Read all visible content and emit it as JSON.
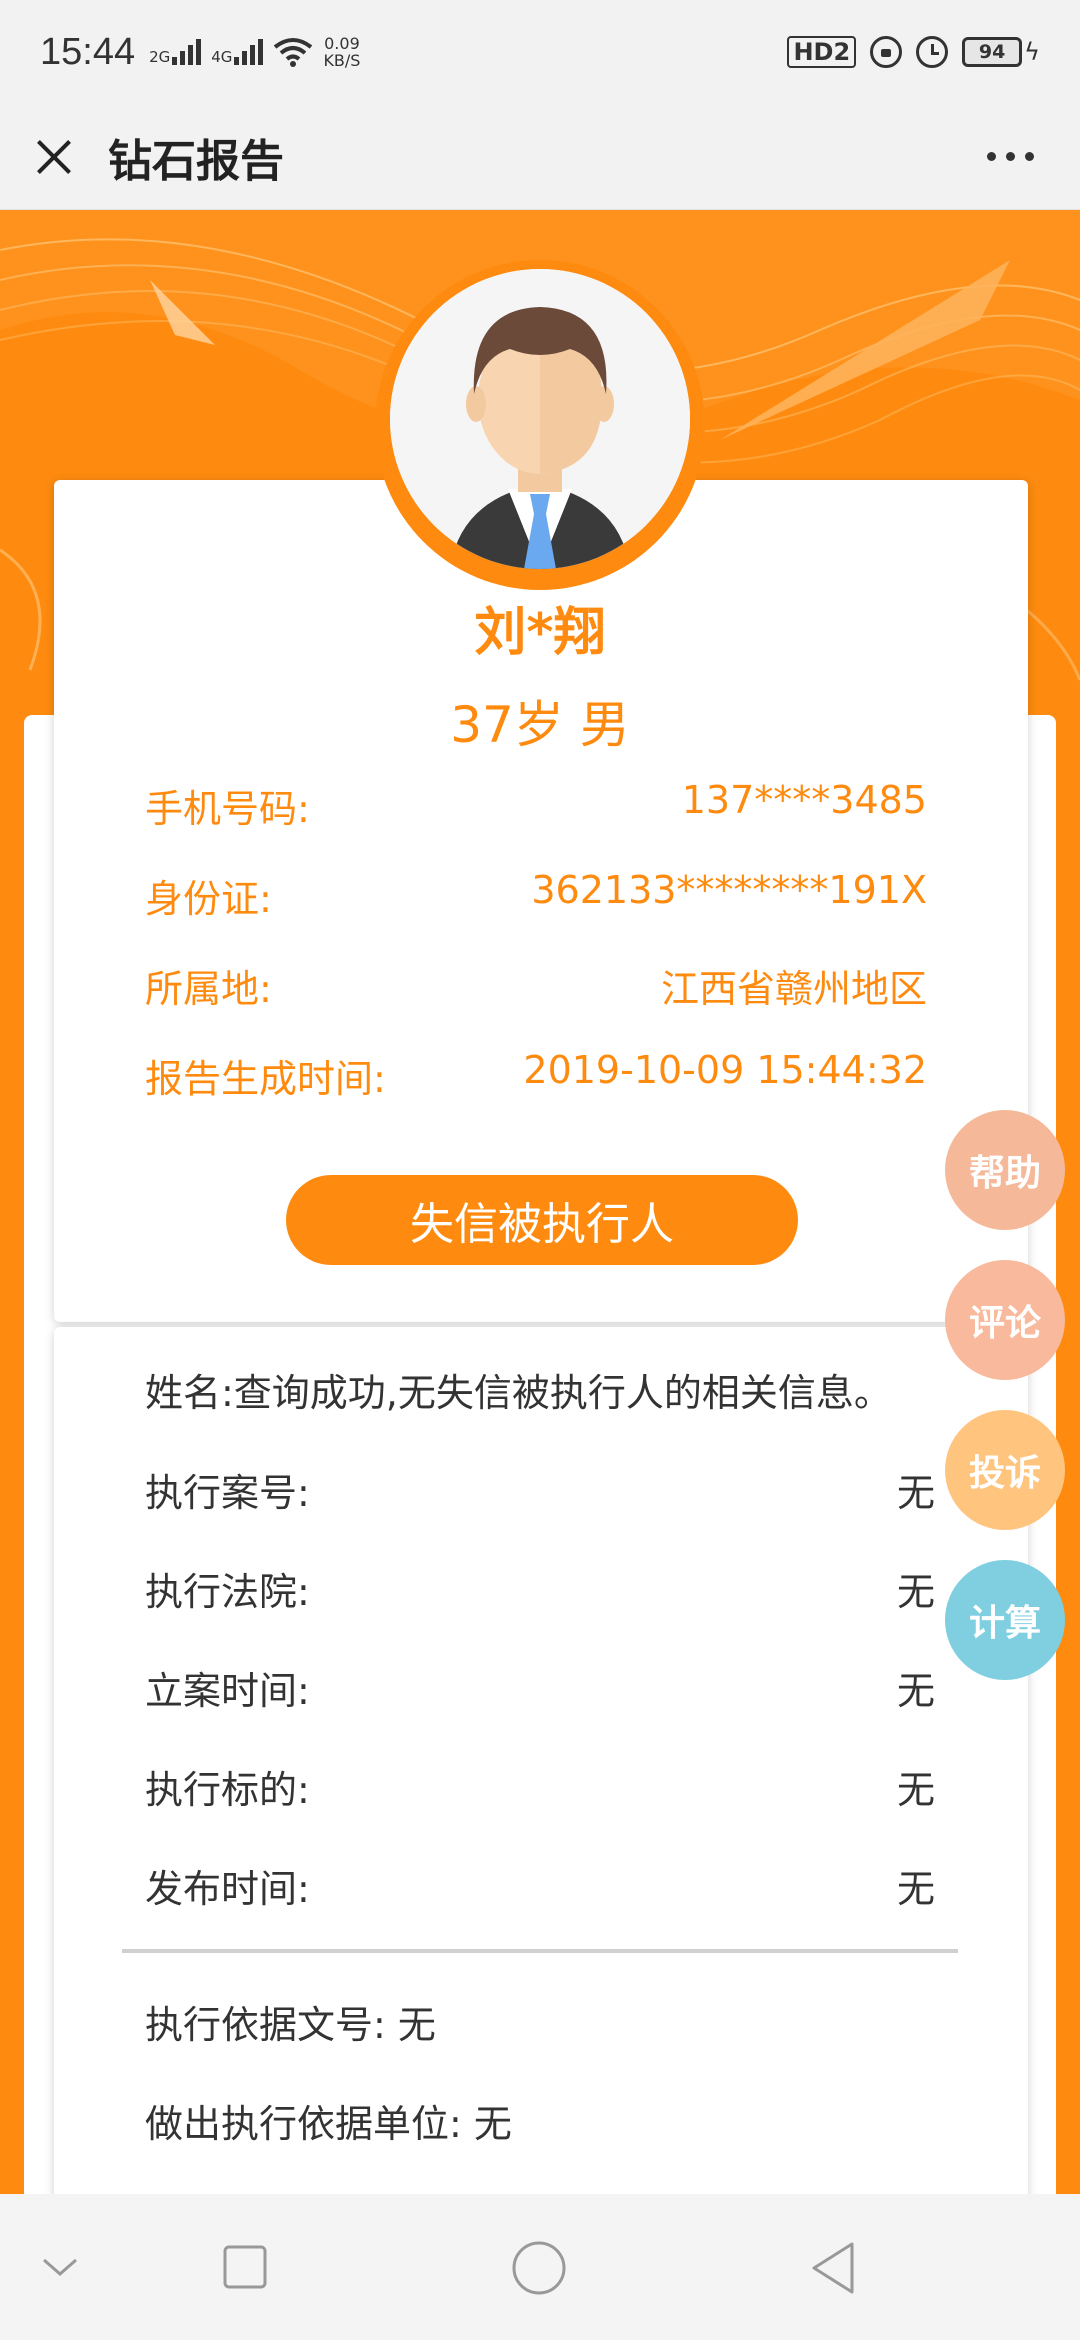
{
  "status_bar": {
    "time": "15:44",
    "signal1_label": "2G",
    "signal2_label": "4G",
    "net_speed_value": "0.09",
    "net_speed_unit": "KB/S",
    "hd_label": "HD2",
    "battery_level": "94",
    "icons": [
      "signal-icon",
      "wifi-icon",
      "hd-icon",
      "lock-rotation-icon",
      "alarm-icon",
      "battery-icon",
      "charging-icon"
    ]
  },
  "title_bar": {
    "title": "钻石报告",
    "close_icon": "close-icon",
    "more_icon": "more-dots-icon"
  },
  "profile": {
    "name": "刘*翔",
    "age_gender": "37岁 男",
    "rows": [
      {
        "label": "手机号码:",
        "value": "137****3485"
      },
      {
        "label": "身份证:",
        "value": "362133********191X"
      },
      {
        "label": "所属地:",
        "value": "江西省赣州地区"
      },
      {
        "label": "报告生成时间:",
        "value": "2019-10-09 15:44:32"
      }
    ]
  },
  "section": {
    "button_label": "失信被执行人"
  },
  "details": {
    "name_line": "姓名:查询成功,无失信被执行人的相关信息。",
    "rows": [
      {
        "label": "执行案号:",
        "value": "无"
      },
      {
        "label": "执行法院:",
        "value": "无"
      },
      {
        "label": "立案时间:",
        "value": "无"
      },
      {
        "label": "执行标的:",
        "value": "无"
      },
      {
        "label": "发布时间:",
        "value": "无"
      }
    ],
    "basis_doc": "执行依据文号: 无",
    "basis_unit": "做出执行依据单位: 无"
  },
  "floating": {
    "help": "帮助",
    "comment": "评论",
    "complain": "投诉",
    "calculate": "计算",
    "colors": {
      "help": "#f5b99a",
      "comment": "#f8b99c",
      "complain": "#ffc47e",
      "calculate": "#7fcfe0"
    }
  },
  "colors": {
    "accent": "#fe8b0f"
  }
}
